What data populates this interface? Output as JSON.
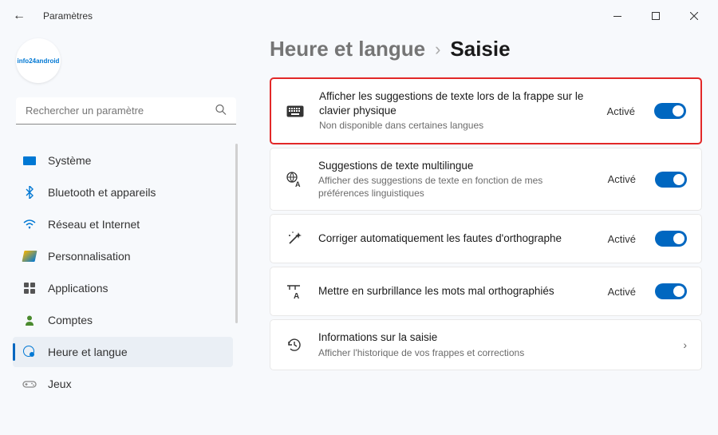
{
  "titlebar": {
    "title": "Paramètres"
  },
  "avatar": {
    "brand_prefix": "info",
    "brand_highlight": "24",
    "brand_suffix": "android"
  },
  "search": {
    "placeholder": "Rechercher un paramètre"
  },
  "sidebar": {
    "items": [
      {
        "label": "Système"
      },
      {
        "label": "Bluetooth et appareils"
      },
      {
        "label": "Réseau et Internet"
      },
      {
        "label": "Personnalisation"
      },
      {
        "label": "Applications"
      },
      {
        "label": "Comptes"
      },
      {
        "label": "Heure et langue"
      },
      {
        "label": "Jeux"
      }
    ],
    "active_index": 6
  },
  "breadcrumb": {
    "parent": "Heure et langue",
    "separator": "›",
    "current": "Saisie"
  },
  "cards": [
    {
      "title": "Afficher les suggestions de texte lors de la frappe sur le clavier physique",
      "subtitle": "Non disponible dans certaines langues",
      "status": "Activé",
      "has_toggle": true,
      "highlighted": true
    },
    {
      "title": "Suggestions de texte multilingue",
      "subtitle": "Afficher des suggestions de texte en fonction de mes préférences linguistiques",
      "status": "Activé",
      "has_toggle": true
    },
    {
      "title": "Corriger automatiquement les fautes d'orthographe",
      "subtitle": "",
      "status": "Activé",
      "has_toggle": true
    },
    {
      "title": "Mettre en surbrillance les mots mal orthographiés",
      "subtitle": "",
      "status": "Activé",
      "has_toggle": true
    },
    {
      "title": "Informations sur la saisie",
      "subtitle": "Afficher l'historique de vos frappes et corrections",
      "status": "",
      "has_chevron": true
    }
  ]
}
